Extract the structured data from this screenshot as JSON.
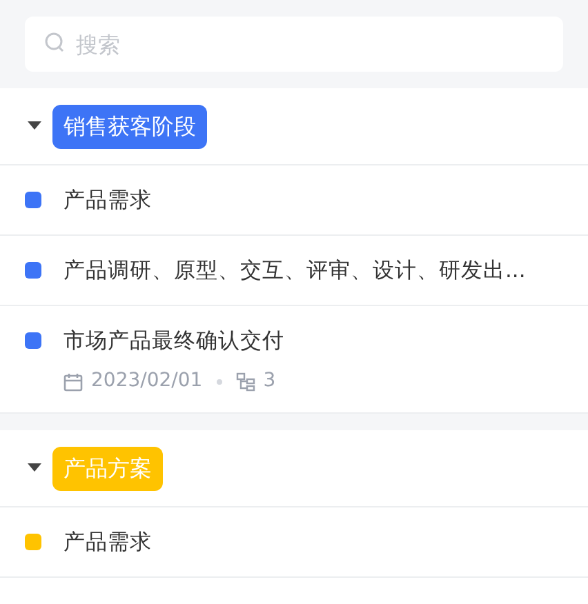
{
  "search": {
    "placeholder": "搜索"
  },
  "groups": [
    {
      "title": "销售获客阶段",
      "color": "#3d74f6",
      "expanded": true,
      "items": [
        {
          "title": "产品需求"
        },
        {
          "title": "产品调研、原型、交互、评审、设计、研发出..."
        },
        {
          "title": "市场产品最终确认交付",
          "date": "2023/02/01",
          "subtasks": "3"
        }
      ]
    },
    {
      "title": "产品方案",
      "color": "#ffc300",
      "expanded": true,
      "items": [
        {
          "title": "产品需求"
        }
      ]
    }
  ]
}
